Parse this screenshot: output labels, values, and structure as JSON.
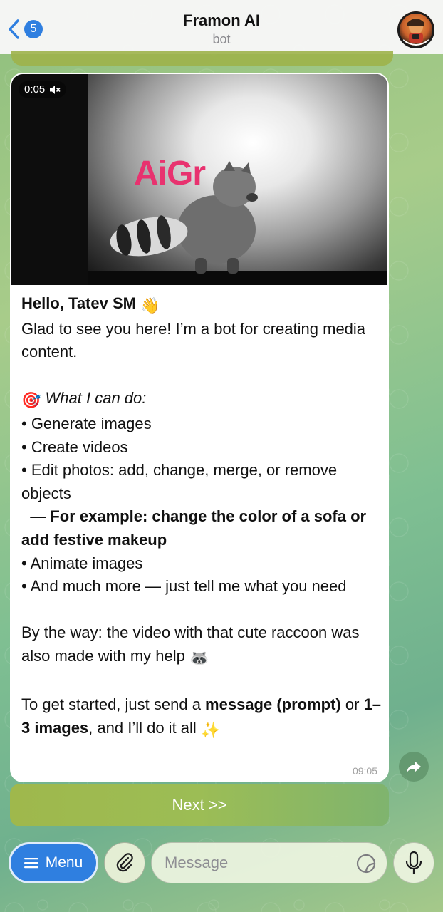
{
  "header": {
    "back_count": "5",
    "title": "Framon AI",
    "subtitle": "bot",
    "avatar_label": "FRAMON AI"
  },
  "video": {
    "duration": "0:05",
    "logo_text": "AiGr"
  },
  "message": {
    "greeting": "Hello, Tatev SM",
    "greeting_emoji": "👋",
    "intro": "Glad to see you here! I’m a bot for creating media content.",
    "can_do_emoji": "🎯",
    "can_do_heading": "What I can do:",
    "features": [
      "• Generate images",
      "• Create videos",
      "• Edit photos: add, change, merge, or remove objects"
    ],
    "example_prefix": "  — ",
    "example": "For example: change the color of a sofa or add festive makeup",
    "features_more": [
      "• Animate images",
      "• And much more — just tell me what you need"
    ],
    "by_the_way": "By the way: the video with that cute raccoon was also made with my help",
    "raccoon_emoji": "🦝",
    "start_1": "To get started, just send a ",
    "start_bold_1": "message (prompt)",
    "start_2": " or ",
    "start_bold_2": "1–3 images",
    "start_3": ", and I’ll do it all",
    "sparkle_emoji": "✨",
    "time": "09:05"
  },
  "buttons": {
    "next": "Next >>"
  },
  "composer": {
    "menu_label": "Menu",
    "placeholder": "Message"
  },
  "colors": {
    "accent": "#2f7fe0",
    "next_button": "#9fb84c"
  }
}
